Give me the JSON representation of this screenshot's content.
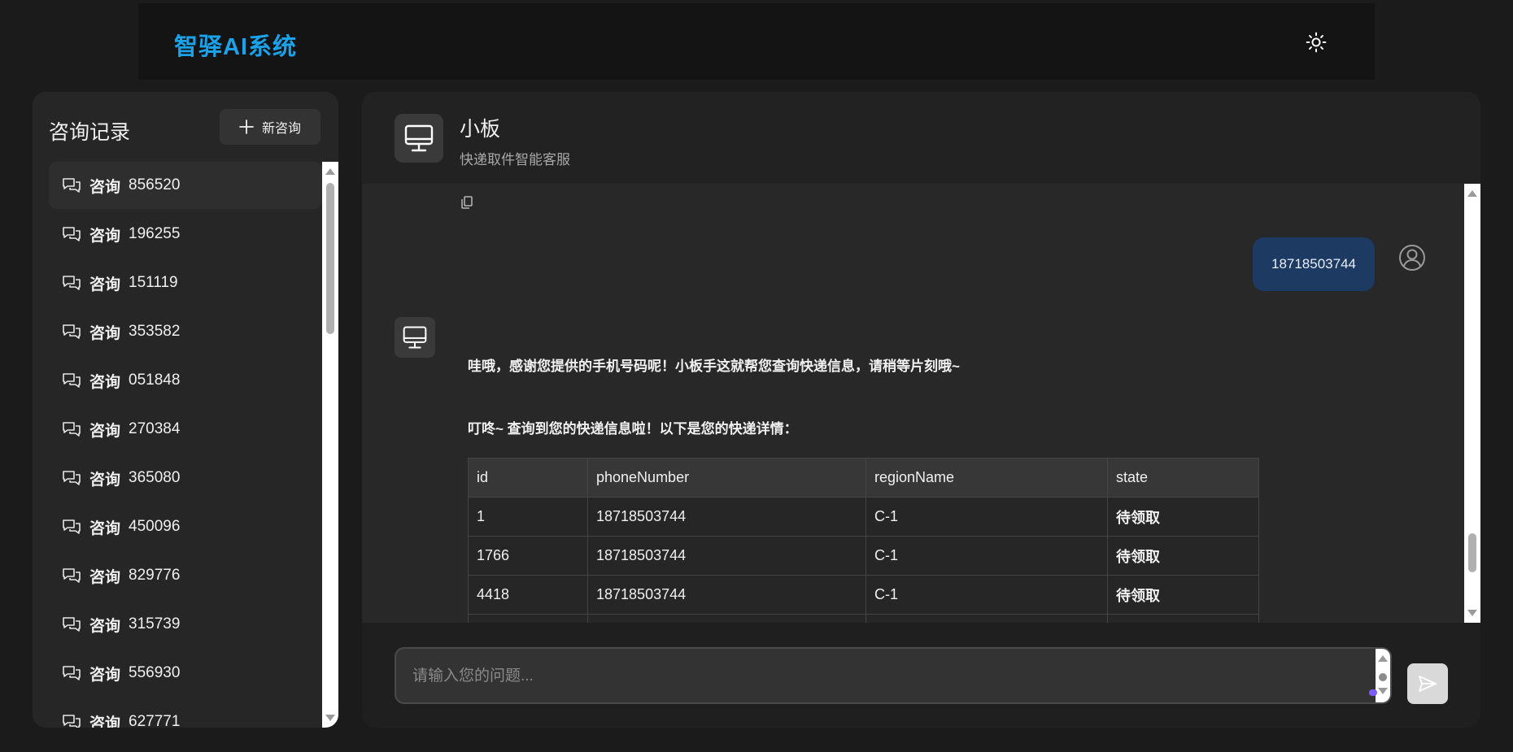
{
  "app": {
    "brand": "智驿AI系统"
  },
  "header": {
    "theme_icon": "sun-icon"
  },
  "sidebar": {
    "title": "咨询记录",
    "new_button": "新咨询",
    "items": [
      {
        "prefix": "咨询",
        "id": "856520",
        "active": true
      },
      {
        "prefix": "咨询",
        "id": "196255"
      },
      {
        "prefix": "咨询",
        "id": "151119"
      },
      {
        "prefix": "咨询",
        "id": "353582"
      },
      {
        "prefix": "咨询",
        "id": "051848"
      },
      {
        "prefix": "咨询",
        "id": "270384"
      },
      {
        "prefix": "咨询",
        "id": "365080"
      },
      {
        "prefix": "咨询",
        "id": "450096"
      },
      {
        "prefix": "咨询",
        "id": "829776"
      },
      {
        "prefix": "咨询",
        "id": "315739"
      },
      {
        "prefix": "咨询",
        "id": "556930"
      },
      {
        "prefix": "咨询",
        "id": "627771"
      }
    ]
  },
  "chat": {
    "bot_name": "小板",
    "bot_desc": "快递取件智能客服",
    "user_message": "18718503744",
    "bot_message_1": "哇哦，感谢您提供的手机号码呢！小板手这就帮您查询快递信息，请稍等片刻哦~",
    "bot_message_2": "叮咚~ 查询到您的快递信息啦！以下是您的快递详情：",
    "table": {
      "headers": [
        "id",
        "phoneNumber",
        "regionName",
        "state"
      ],
      "rows": [
        [
          "1",
          "18718503744",
          "C-1",
          "待领取"
        ],
        [
          "1766",
          "18718503744",
          "C-1",
          "待领取"
        ],
        [
          "4418",
          "18718503744",
          "C-1",
          "待领取"
        ]
      ]
    }
  },
  "input": {
    "placeholder": "请输入您的问题..."
  },
  "colors": {
    "brand": "#1aa3ea",
    "user_bubble": "#1d3a63",
    "panel": "#262626",
    "resize_handle": "#7c5cff"
  }
}
